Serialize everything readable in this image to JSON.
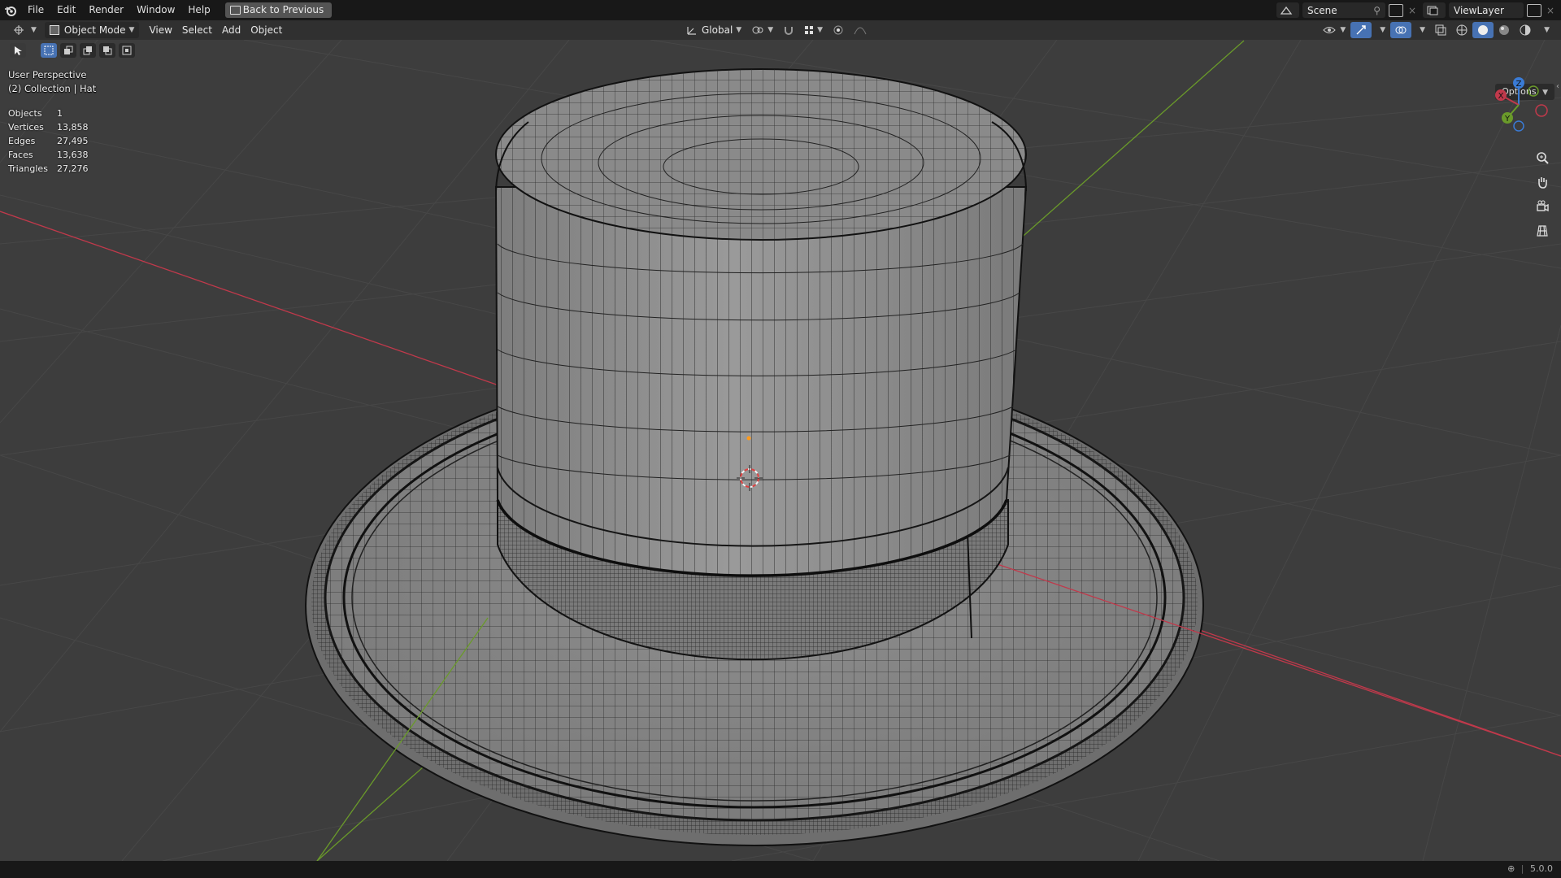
{
  "topbar": {
    "menu": [
      "File",
      "Edit",
      "Render",
      "Window",
      "Help"
    ],
    "back_button": "Back to Previous",
    "scene": "Scene",
    "view_layer": "ViewLayer"
  },
  "header": {
    "mode": "Object Mode",
    "menus": [
      "View",
      "Select",
      "Add",
      "Object"
    ],
    "transform_orientation": "Global",
    "options_label": "Options"
  },
  "viewport": {
    "perspective_label": "User Perspective",
    "collection_label": "(2) Collection | Hat",
    "stats": [
      {
        "label": "Objects",
        "value": "1"
      },
      {
        "label": "Vertices",
        "value": "13,858"
      },
      {
        "label": "Edges",
        "value": "27,495"
      },
      {
        "label": "Faces",
        "value": "13,638"
      },
      {
        "label": "Triangles",
        "value": "27,276"
      }
    ],
    "gizmo_axes": [
      "X",
      "Y",
      "Z"
    ]
  },
  "status": {
    "version": "5.0.0"
  },
  "colors": {
    "axis_x": "#c0394b",
    "axis_y": "#6a9a2a",
    "axis_z": "#3a7bd5",
    "mesh_fill": "#8e8e8e",
    "wire": "#1a1a1a"
  }
}
